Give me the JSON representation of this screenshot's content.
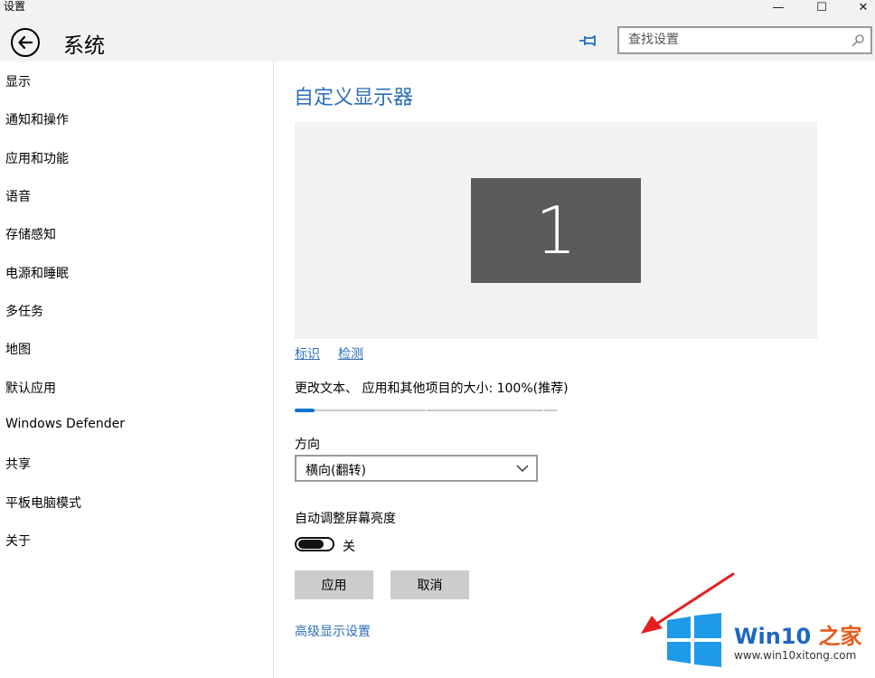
{
  "window": {
    "title": "设置",
    "controls": {
      "minimize": "—",
      "maximize": "☐",
      "close": "✕"
    }
  },
  "header": {
    "back_icon": "back-arrow-icon",
    "title": "系统",
    "pin_icon": "pin-icon",
    "search": {
      "placeholder": "查找设置",
      "value": "",
      "icon": "search-icon"
    }
  },
  "sidebar": {
    "items": [
      {
        "label": "显示"
      },
      {
        "label": "通知和操作"
      },
      {
        "label": "应用和功能"
      },
      {
        "label": "语音"
      },
      {
        "label": "存储感知"
      },
      {
        "label": "电源和睡眠"
      },
      {
        "label": "多任务"
      },
      {
        "label": "地图"
      },
      {
        "label": "默认应用"
      },
      {
        "label": "Windows Defender"
      },
      {
        "label": "共享"
      },
      {
        "label": "平板电脑模式"
      },
      {
        "label": "关于"
      }
    ]
  },
  "main": {
    "title": "自定义显示器",
    "preview": {
      "monitor_label": "1"
    },
    "links": {
      "identify": "标识",
      "detect": "检测"
    },
    "scale": {
      "label": "更改文本、 应用和其他项目的大小: 100%(推荐)",
      "value_fraction": 0.0
    },
    "orientation": {
      "label": "方向",
      "value": "横向(翻转)"
    },
    "brightness": {
      "label": "自动调整屏幕亮度",
      "toggle_state": "关",
      "is_on": false
    },
    "buttons": {
      "apply": "应用",
      "cancel": "取消"
    },
    "advanced_link": "高级显示设置"
  },
  "annotation": {
    "arrow_color": "#e32020"
  },
  "watermark": {
    "brand": "Win10",
    "suffix": "之家",
    "url": "www.win10xitong.com"
  },
  "colors": {
    "accent": "#2d6fb4",
    "slider": "#0a72d1",
    "button": "#cccccc",
    "header_bg": "#f2f2f2"
  }
}
